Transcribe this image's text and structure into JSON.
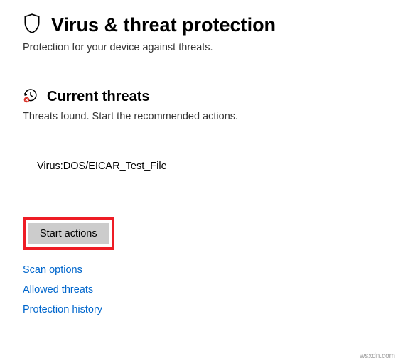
{
  "header": {
    "title": "Virus & threat protection",
    "subtitle": "Protection for your device against threats."
  },
  "section": {
    "title": "Current threats",
    "description": "Threats found. Start the recommended actions."
  },
  "threat": {
    "name": "Virus:DOS/EICAR_Test_File"
  },
  "actions": {
    "start_label": "Start actions"
  },
  "links": {
    "scan_options": "Scan options",
    "allowed_threats": "Allowed threats",
    "protection_history": "Protection history"
  },
  "watermark": "wsxdn.com"
}
